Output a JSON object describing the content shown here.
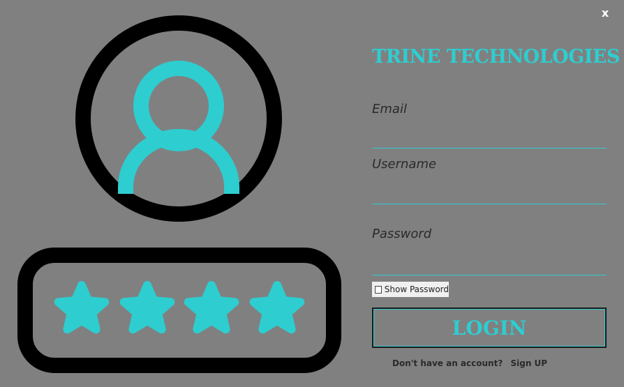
{
  "window": {
    "close_label": "x"
  },
  "brand": {
    "title": "TRINE TECHNOLOGIES"
  },
  "form": {
    "email": {
      "label": "Email",
      "value": ""
    },
    "username": {
      "label": "Username",
      "value": ""
    },
    "password": {
      "label": "Password",
      "value": ""
    },
    "show_password": {
      "label": "Show Password",
      "checked": false
    },
    "login_label": "LOGIN"
  },
  "footer": {
    "prompt": "Don't have an account?",
    "signup_label": "Sign UP"
  },
  "art": {
    "icons": [
      "user-avatar-icon",
      "password-asterisks-icon"
    ]
  },
  "colors": {
    "background": "#808080",
    "accent": "#2ecdd0",
    "outline": "#000000"
  }
}
